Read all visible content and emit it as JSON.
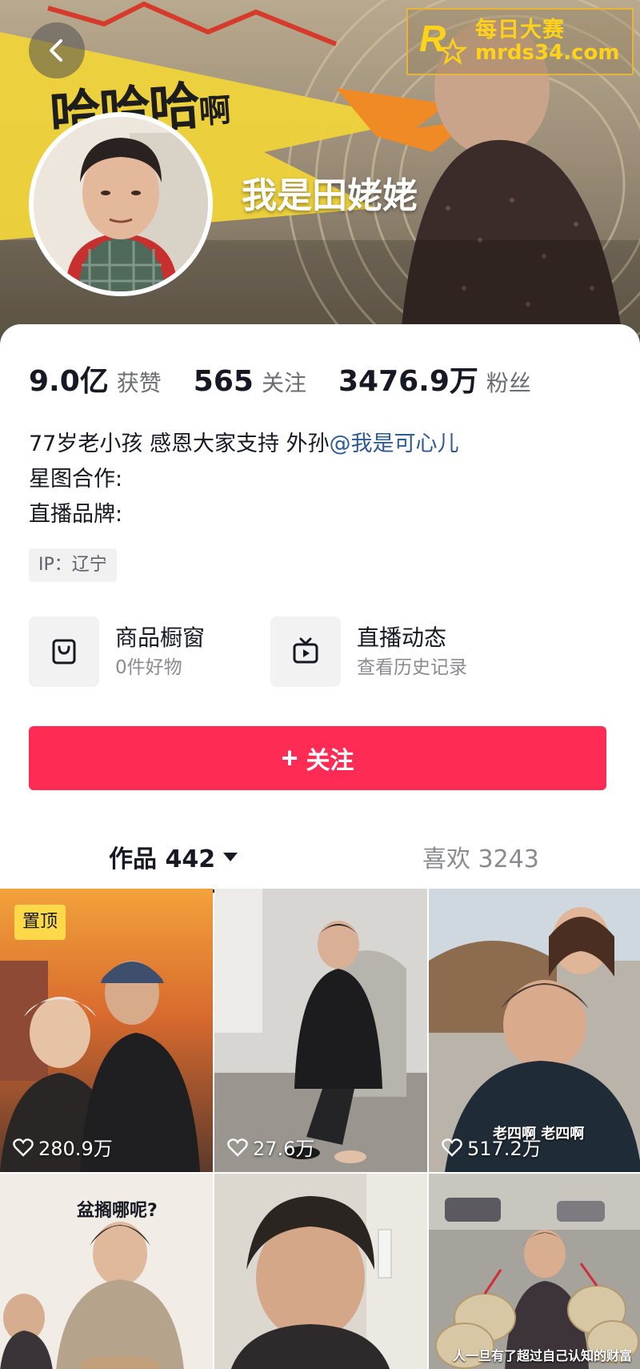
{
  "header": {
    "nickname": "我是田姥姥",
    "banner_art_text": "哈哈哈",
    "banner_art_small": "啊",
    "back_icon": "chevron-left-icon"
  },
  "watermark": {
    "title": "每日大赛",
    "url": "mrds34.com",
    "color": "#ffd21a"
  },
  "stats": [
    {
      "value": "9.0亿",
      "label": "获赞"
    },
    {
      "value": "565",
      "label": "关注"
    },
    {
      "value": "3476.9万",
      "label": "粉丝"
    }
  ],
  "bio": {
    "line1_text": "77岁老小孩 感恩大家支持 外孙",
    "line1_mention": "@我是可心儿",
    "line2": "星图合作:",
    "line3": "直播品牌:"
  },
  "ip_tag": "IP：辽宁",
  "features": [
    {
      "title": "商品橱窗",
      "subtitle": "0件好物",
      "icon": "shopping-bag-icon"
    },
    {
      "title": "直播动态",
      "subtitle": "查看历史记录",
      "icon": "tv-icon"
    }
  ],
  "follow_button": {
    "label": "关注",
    "color": "#fe2c55"
  },
  "tabs": {
    "works": "作品 442",
    "likes": "喜欢 3243"
  },
  "videos": [
    {
      "likes": "280.9万",
      "badge": "置顶"
    },
    {
      "likes": "27.6万"
    },
    {
      "likes": "517.2万",
      "overlay": "老四啊 老四啊"
    },
    {
      "caption": "盆搁哪呢?"
    },
    {},
    {
      "overlay": "人一旦有了超过自己认知的财富"
    }
  ],
  "colors": {
    "accent": "#fe2c55",
    "mention": "#2e5a96",
    "badge": "#fdd848"
  }
}
